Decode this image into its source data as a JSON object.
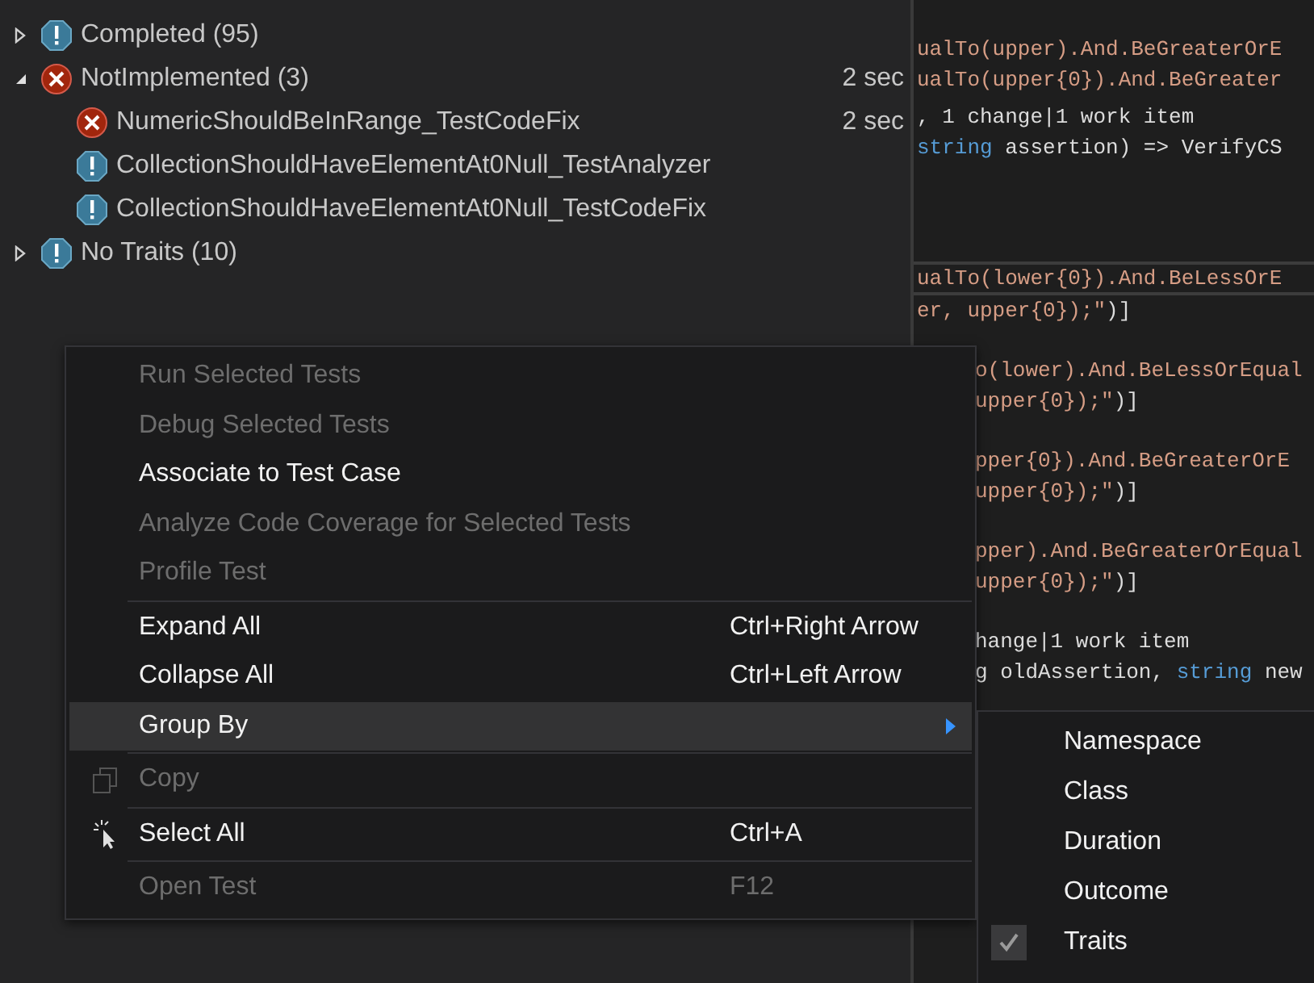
{
  "tree": [
    {
      "label": "Completed (95)",
      "kind": "warning",
      "expanded": false
    },
    {
      "label": "NotImplemented (3)",
      "kind": "failed",
      "expanded": true,
      "time": "2 sec",
      "children": [
        {
          "label": "NumericShouldBeInRange_TestCodeFix",
          "kind": "failed",
          "time": "2 sec"
        },
        {
          "label": "CollectionShouldHaveElementAt0Null_TestAnalyzer",
          "kind": "warning"
        },
        {
          "label": "CollectionShouldHaveElementAt0Null_TestCodeFix",
          "kind": "warning"
        }
      ]
    },
    {
      "label": "No Traits (10)",
      "kind": "warning",
      "expanded": false
    }
  ],
  "code": {
    "blocks_top": [
      [
        [
          {
            "t": "ualTo(upper).And.BeGreaterOrE",
            "kind": "string"
          }
        ],
        [
          {
            "t": "ualTo(upper{0}).And.BeGreater",
            "kind": "string"
          }
        ]
      ],
      [
        [
          {
            "t": ", 1 change|1 work item",
            "kind": "lens"
          }
        ],
        [
          {
            "t": "string",
            "kind": "keyword"
          },
          {
            "t": " assertion) => VerifyCS",
            "kind": "plain"
          }
        ]
      ],
      [
        [
          {
            "t": "ualTo(lower{0}).And.BeLessOrE",
            "kind": "string"
          }
        ],
        [
          {
            "t": "er, upper{0});\"",
            "kind": "string"
          },
          {
            "t": ")]",
            "kind": "plain"
          }
        ]
      ]
    ],
    "blocks_beside_menu": [
      [
        [
          {
            "t": "o(lower).And.BeLessOrEqual",
            "kind": "string"
          }
        ],
        [
          {
            "t": "upper{0});\"",
            "kind": "string"
          },
          {
            "t": ")]",
            "kind": "plain"
          }
        ]
      ],
      [
        [
          {
            "t": "pper{0}).And.BeGreaterOrE",
            "kind": "string"
          }
        ],
        [
          {
            "t": "upper{0});\"",
            "kind": "string"
          },
          {
            "t": ")]",
            "kind": "plain"
          }
        ]
      ],
      [
        [
          {
            "t": "pper).And.BeGreaterOrEqual",
            "kind": "string"
          }
        ],
        [
          {
            "t": "upper{0});\"",
            "kind": "string"
          },
          {
            "t": ")]",
            "kind": "plain"
          }
        ]
      ],
      [
        [
          {
            "t": "hange|1 work item",
            "kind": "lens"
          }
        ],
        [
          {
            "t": "g oldAssertion, ",
            "kind": "plain"
          },
          {
            "t": "string",
            "kind": "keyword"
          },
          {
            "t": " new",
            "kind": "plain"
          }
        ]
      ]
    ]
  },
  "context_menu": [
    [
      {
        "label": "Run Selected Tests",
        "kind": "plain",
        "disabled": true,
        "selected": false,
        "submenu": false
      },
      {
        "label": "Debug Selected Tests",
        "kind": "plain",
        "disabled": true,
        "selected": false,
        "submenu": false
      },
      {
        "label": "Associate to Test Case",
        "kind": "plain",
        "disabled": false,
        "selected": false,
        "submenu": false
      },
      {
        "label": "Analyze Code Coverage for Selected Tests",
        "kind": "plain",
        "disabled": true,
        "selected": false,
        "submenu": false
      },
      {
        "label": "Profile Test",
        "kind": "plain",
        "disabled": true,
        "selected": false,
        "submenu": false
      }
    ],
    [
      {
        "label": "Expand All",
        "shortcut": "Ctrl+Right Arrow",
        "kind": "plain",
        "disabled": false,
        "selected": false,
        "submenu": false
      },
      {
        "label": "Collapse All",
        "shortcut": "Ctrl+Left Arrow",
        "kind": "plain",
        "disabled": false,
        "selected": false,
        "submenu": false
      },
      {
        "label": "Group By",
        "kind": "plain",
        "disabled": false,
        "selected": true,
        "submenu": true
      }
    ],
    [
      {
        "label": "Copy",
        "kind": "copy",
        "disabled": true,
        "selected": false,
        "submenu": false
      }
    ],
    [
      {
        "label": "Select All",
        "shortcut": "Ctrl+A",
        "kind": "pointer",
        "disabled": false,
        "selected": false,
        "submenu": false
      }
    ],
    [
      {
        "label": "Open Test",
        "shortcut": "F12",
        "kind": "plain",
        "disabled": true,
        "selected": false,
        "submenu": false
      }
    ]
  ],
  "submenu": [
    {
      "label": "Namespace",
      "checked": false
    },
    {
      "label": "Class",
      "checked": false
    },
    {
      "label": "Duration",
      "checked": false
    },
    {
      "label": "Outcome",
      "checked": false
    },
    {
      "label": "Traits",
      "checked": true
    }
  ]
}
